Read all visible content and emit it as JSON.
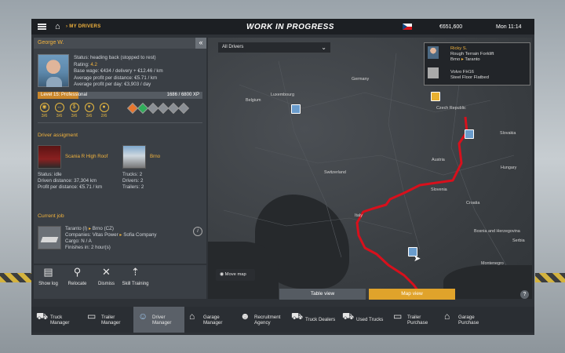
{
  "topbar": {
    "breadcrumb": "MY DRIVERS",
    "title": "WORK IN PROGRESS",
    "money": "€651,600",
    "time": "Mon 11:14"
  },
  "driver": {
    "name": "George W.",
    "status": "Status: heading back (stopped to rest)",
    "rating_label": "Rating:",
    "rating_value": "4.2",
    "base_wage": "Base wage: €434 / delivery + €12.46 / km",
    "avg_profit_km": "Average profit per distance: €5.71 / km",
    "avg_profit_day": "Average profit per day: €3,903 / day",
    "level": "Level 15: Professional",
    "xp": "1686 / 6800 XP",
    "xp_fraction": 0.248,
    "skills": [
      {
        "icon": "adr-skill-icon",
        "level": "3/6"
      },
      {
        "icon": "long-distance-skill-icon",
        "level": "3/6"
      },
      {
        "icon": "high-value-cargo-skill-icon",
        "level": "3/6"
      },
      {
        "icon": "fragile-cargo-skill-icon",
        "level": "3/6"
      },
      {
        "icon": "eco-driving-skill-icon",
        "level": "2/6"
      }
    ],
    "adr_colors": [
      "#e8762d",
      "#2fae5a",
      "#8a8f95",
      "#8a8f95",
      "#8a8f95",
      "#8a8f95"
    ]
  },
  "assignment": {
    "title": "Driver assigment",
    "truck_name": "Scania R High Roof",
    "garage_name": "Brno",
    "status": "Status: idle",
    "distance": "Driven distance: 37,304 km",
    "profit": "Profit per distance: €5.71 / km",
    "trucks": "Trucks: 2",
    "drivers": "Drivers: 2",
    "trailers": "Trailers: 2"
  },
  "job": {
    "title": "Current job",
    "route_from": "Taranto (I)",
    "route_to": "Brno (CZ)",
    "companies": "Companies: Vitas Power",
    "company_to": "Sofia Company",
    "cargo": "Cargo: N / A",
    "finishes": "Finishes in: 2 hour(s)"
  },
  "actions": [
    {
      "label": "Show log",
      "icon": "log-icon"
    },
    {
      "label": "Relocate",
      "icon": "relocate-icon"
    },
    {
      "label": "Dismiss",
      "icon": "dismiss-icon"
    },
    {
      "label": "Skill Training",
      "icon": "skill-training-icon"
    }
  ],
  "map": {
    "filter": "All Drivers",
    "countries": [
      "Germany",
      "Belgium",
      "Luxembourg",
      "Czech Republic",
      "Slovakia",
      "Austria",
      "Hungary",
      "Switzerland",
      "Slovenia",
      "Croatia",
      "Italy",
      "Bosnia and Herzegovina",
      "Serbia",
      "Montenegro"
    ],
    "popup": {
      "driver": "Ricky S.",
      "job": "Rough Terrain Forklift",
      "from": "Brno",
      "to": "Taranto",
      "truck": "Volvo FH16",
      "trailer": "Steel Floor Flatbed"
    },
    "move_map": "Move map",
    "table_view": "Table view",
    "map_view": "Map view",
    "help": "?",
    "route_color": "#d8101c",
    "accent_color": "#e8b030"
  },
  "bottom_nav": [
    {
      "label": "Truck Manager",
      "icon": "truck-icon"
    },
    {
      "label": "Trailer Manager",
      "icon": "trailer-icon"
    },
    {
      "label": "Driver Manager",
      "icon": "driver-icon",
      "active": true
    },
    {
      "label": "Garage Manager",
      "icon": "garage-icon"
    },
    {
      "label": "Recruitment Agency",
      "icon": "recruitment-icon"
    },
    {
      "label": "Truck Dealers",
      "icon": "dealer-icon"
    },
    {
      "label": "Used Trucks",
      "icon": "used-truck-icon"
    },
    {
      "label": "Trailer Purchase",
      "icon": "trailer-purchase-icon"
    },
    {
      "label": "Garage Purchase",
      "icon": "garage-purchase-icon"
    }
  ]
}
